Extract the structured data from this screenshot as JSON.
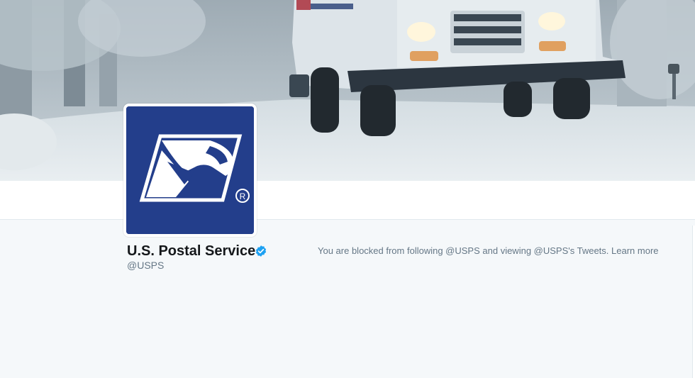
{
  "profile": {
    "name": "U.S. Postal Service",
    "screen_name": "@USPS",
    "verified": true,
    "avatar_icon": "usps-eagle-logo",
    "avatar_bg": "#233e8b"
  },
  "notice": {
    "text": "You are blocked from following @USPS and viewing @USPS's Tweets. ",
    "link": "Learn more"
  },
  "colors": {
    "verified": "#1da1f2",
    "page_bg": "#f5f8fa",
    "muted_text": "#657786"
  }
}
